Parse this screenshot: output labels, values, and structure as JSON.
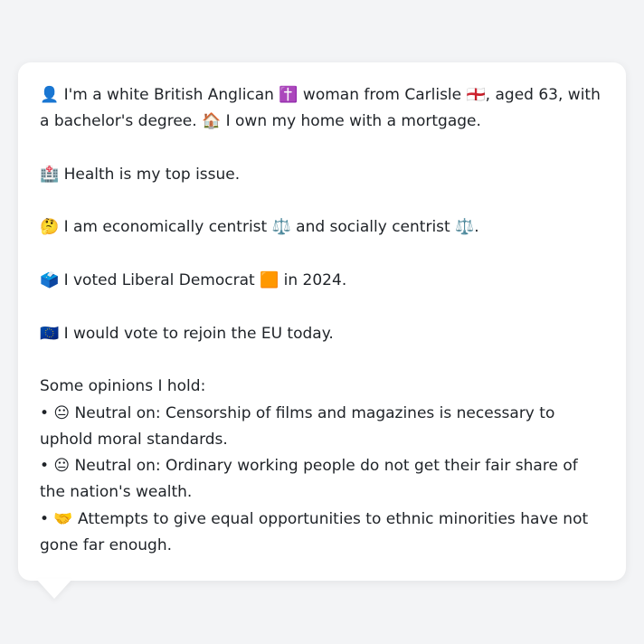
{
  "profile": {
    "intro": "👤 I'm a white British Anglican ✝️ woman from Carlisle 🏴󠁧󠁢󠁥󠁮󠁧󠁿, aged 63, with a bachelor's degree. 🏠 I own my home with a mortgage.",
    "top_issue": "🏥 Health is my top issue.",
    "ideology": "🤔 I am economically centrist ⚖️ and socially centrist ⚖️.",
    "vote_2024": "🗳️ I voted Liberal Democrat 🟧 in 2024.",
    "eu": "🇪🇺 I would vote to rejoin the EU today.",
    "opinions_heading": "Some opinions I hold:",
    "opinions": [
      "• 😐 Neutral on: Censorship of films and magazines is necessary to uphold moral standards.",
      "• 😐 Neutral on: Ordinary working people do not get their fair share of the nation's wealth.",
      "• 🤝 Attempts to give equal opportunities to ethnic minorities have not gone far enough."
    ]
  }
}
